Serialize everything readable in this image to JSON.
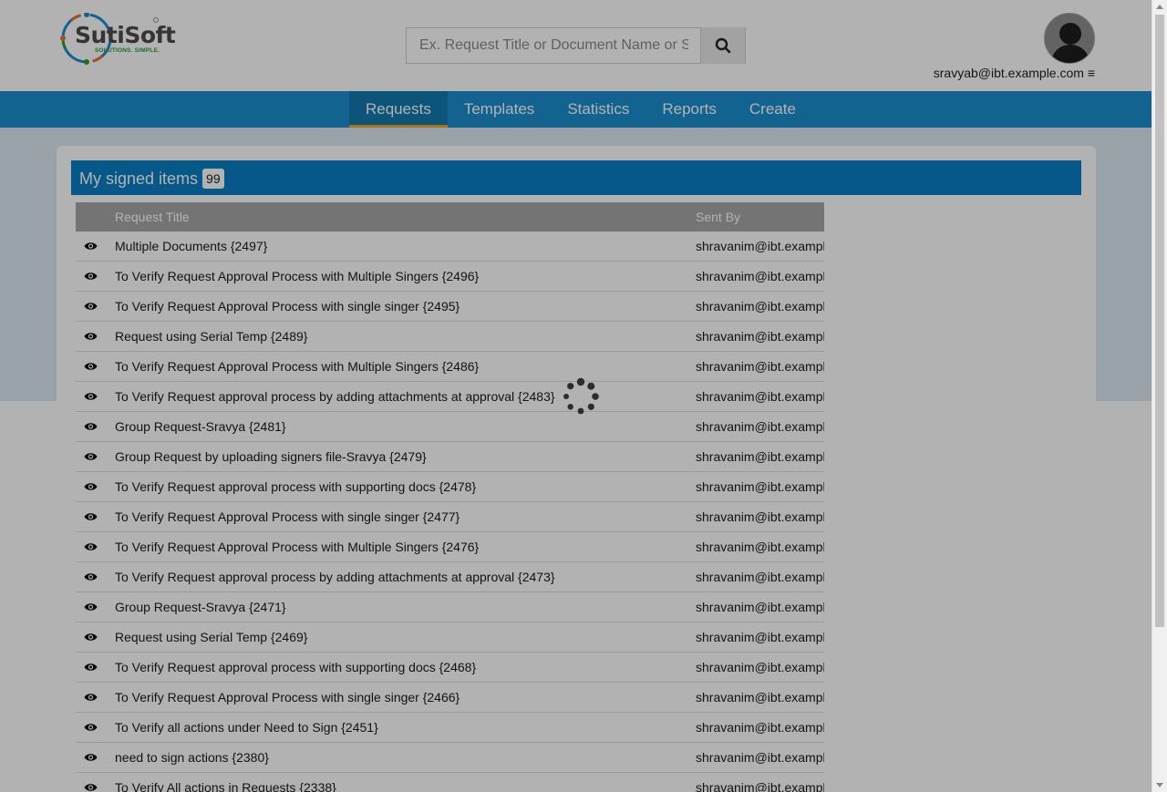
{
  "brand": {
    "name": "SutiSoft",
    "tagline": "SOLUTIONS. SIMPLE.",
    "colors": {
      "primary": "#1b8fcf",
      "panel": "#0a7fc3",
      "accent": "#f3a41a",
      "green": "#2a9b3a",
      "orange": "#e8762d"
    }
  },
  "search": {
    "placeholder": "Ex. Request Title or Document Name or S",
    "icon": "search-icon"
  },
  "user": {
    "email": "sravyab@ibt.example.com",
    "menu_icon": "hamburger-icon"
  },
  "nav": {
    "items": [
      {
        "label": "Requests",
        "active": true
      },
      {
        "label": "Templates",
        "active": false
      },
      {
        "label": "Statistics",
        "active": false
      },
      {
        "label": "Reports",
        "active": false
      },
      {
        "label": "Create",
        "active": false
      }
    ]
  },
  "panel": {
    "title": "My signed items",
    "count": "99"
  },
  "table": {
    "columns": {
      "view": "",
      "title": "Request Title",
      "sender": "Sent By"
    },
    "rows": [
      {
        "title": "Multiple Documents {2497}",
        "sender": "shravanim@ibt.example.com"
      },
      {
        "title": "To Verify Request Approval Process with Multiple Singers {2496}",
        "sender": "shravanim@ibt.example.com"
      },
      {
        "title": "To Verify Request Approval Process with single singer {2495}",
        "sender": "shravanim@ibt.example.com"
      },
      {
        "title": "Request using Serial Temp {2489}",
        "sender": "shravanim@ibt.example.com"
      },
      {
        "title": "To Verify Request Approval Process with Multiple Singers {2486}",
        "sender": "shravanim@ibt.example.com"
      },
      {
        "title": "To Verify Request approval process by adding attachments at approval {2483}",
        "sender": "shravanim@ibt.example.com"
      },
      {
        "title": "Group Request-Sravya {2481}",
        "sender": "shravanim@ibt.example.com"
      },
      {
        "title": "Group Request by uploading signers file-Sravya {2479}",
        "sender": "shravanim@ibt.example.com"
      },
      {
        "title": "To Verify Request approval process with supporting docs {2478}",
        "sender": "shravanim@ibt.example.com"
      },
      {
        "title": "To Verify Request Approval Process with single singer {2477}",
        "sender": "shravanim@ibt.example.com"
      },
      {
        "title": "To Verify Request Approval Process with Multiple Singers {2476}",
        "sender": "shravanim@ibt.example.com"
      },
      {
        "title": "To Verify Request approval process by adding attachments at approval {2473}",
        "sender": "shravanim@ibt.example.com"
      },
      {
        "title": "Group Request-Sravya {2471}",
        "sender": "shravanim@ibt.example.com"
      },
      {
        "title": "Request using Serial Temp {2469}",
        "sender": "shravanim@ibt.example.com"
      },
      {
        "title": "To Verify Request approval process with supporting docs {2468}",
        "sender": "shravanim@ibt.example.com"
      },
      {
        "title": "To Verify Request Approval Process with single singer {2466}",
        "sender": "shravanim@ibt.example.com"
      },
      {
        "title": "To Verify all actions under Need to Sign {2451}",
        "sender": "shravanim@ibt.example.com"
      },
      {
        "title": "need to sign actions {2380}",
        "sender": "shravanim@ibt.example.com"
      },
      {
        "title": "To Verify All actions in Requests {2338}",
        "sender": "shravanim@ibt.example.com"
      }
    ]
  },
  "loading": {
    "icon": "loading-spinner-icon"
  }
}
